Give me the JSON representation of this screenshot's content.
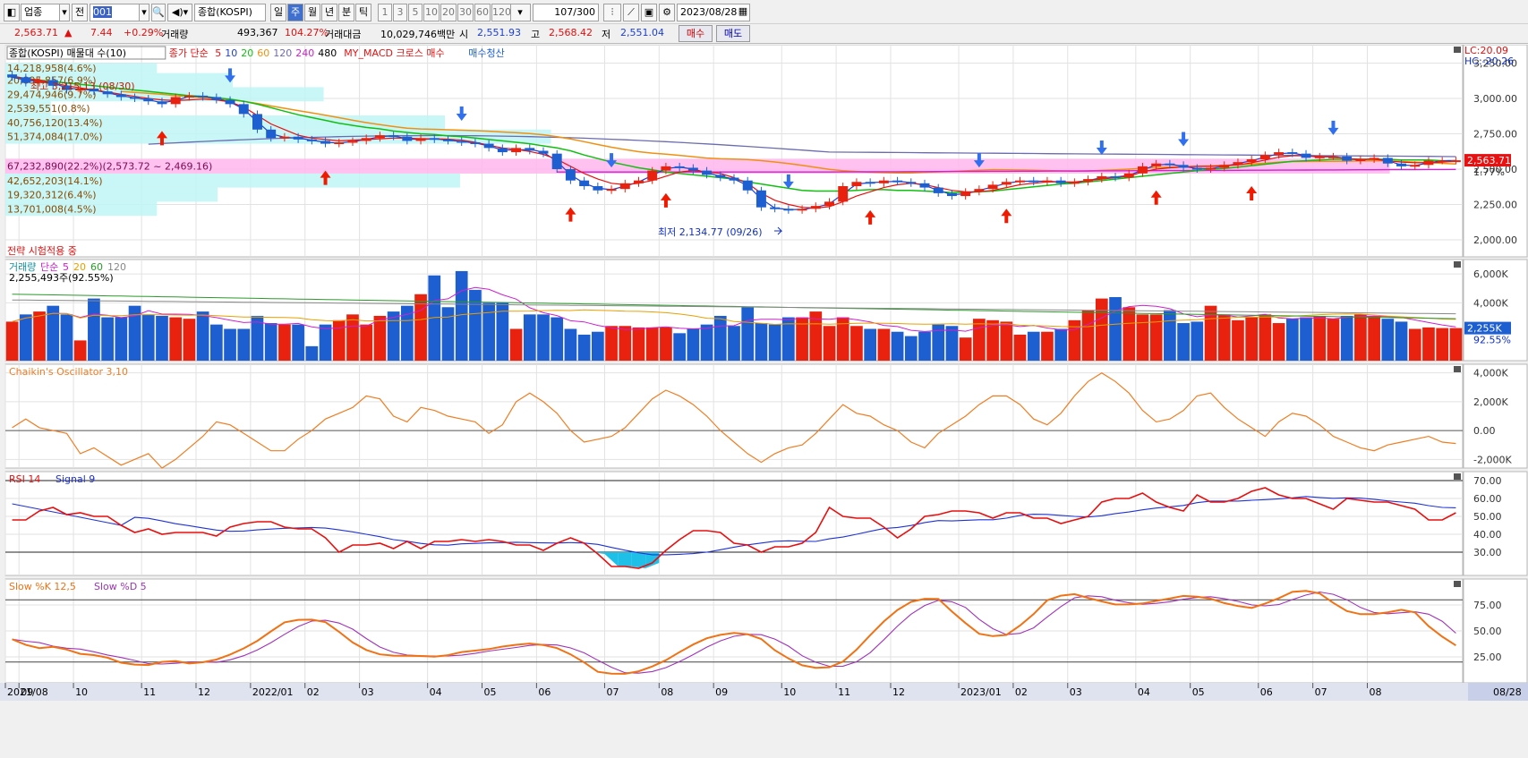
{
  "toolbar": {
    "market_select": "업종",
    "prev_label": "전",
    "code_value": "001",
    "name_value": "종합(KOSPI)",
    "periods": [
      "일",
      "주",
      "월",
      "년",
      "분",
      "틱"
    ],
    "active_period": "주",
    "numbers": [
      "1",
      "3",
      "5",
      "10",
      "20",
      "30",
      "60",
      "120"
    ],
    "count_value": "107",
    "count_total": "/300",
    "date_value": "2023/08/28"
  },
  "quote": {
    "price": "2,563.71",
    "change_arrow": "▲",
    "change": "7.44",
    "change_pct": "+0.29%",
    "volume_label": "거래량",
    "volume": "493,367",
    "volume_pct": "104.27%",
    "amount_label": "거래대금",
    "amount": "10,029,746백만",
    "open_label": "시",
    "open": "2,551.93",
    "high_label": "고",
    "high": "2,568.42",
    "low_label": "저",
    "low": "2,551.04",
    "buy_label": "매수",
    "sell_label": "매도"
  },
  "colors": {
    "up": "#e8220e",
    "down": "#1d5fd1",
    "ma5": "#e81010",
    "ma10": "#1d3fd0",
    "ma20": "#10c010",
    "ma60": "#f09010",
    "ma120": "#6b6bb0",
    "ma240": "#d020d0",
    "ma480": "#000000",
    "grid": "#e2e2e2",
    "band": "#bff5f5",
    "pinkband": "#ffb6ec",
    "chaikin": "#f07d22",
    "rsi": "#e80e0e",
    "signal": "#1e33d8",
    "slowk": "#f07214",
    "slowd": "#a033b8",
    "fill_low": "#1ec0e8",
    "fill_high": "#f0a080"
  },
  "price_panel": {
    "title_parts": [
      "종합(KOSPI) 매물대 수(10)",
      "종가 단순",
      "5",
      "10",
      "20",
      "60",
      "120",
      "240",
      "480",
      "MY_MACD 크로스 매수",
      "매수청산"
    ],
    "status": "전략 시험적용 중",
    "high_label": "최고 3,215.13 (08/30)",
    "low_label": "최저 2,134.77 (09/26)",
    "lc": "LC:20.09",
    "hc": "HC:-20.26",
    "current": "2,563.71",
    "current_pct": "1.77%",
    "y_ticks": [
      "3,250.00",
      "3,000.00",
      "2,750.00",
      "2,500.00",
      "2,250.00",
      "2,000.00"
    ],
    "y_vals": [
      3250,
      3000,
      2750,
      2500,
      2250,
      2000
    ],
    "profile": [
      {
        "label": "14,218,958(4.6%)",
        "w": 0.2,
        "lo": 3180,
        "hi": 3250
      },
      {
        "label": "20,895,857(6.9%)",
        "w": 0.3,
        "lo": 3080,
        "hi": 3180
      },
      {
        "label": "29,474,946(9.7%)",
        "w": 0.42,
        "lo": 2980,
        "hi": 3080
      },
      {
        "label": "2,539,551(0.8%)",
        "w": 0.06,
        "lo": 2880,
        "hi": 2980
      },
      {
        "label": "40,756,120(13.4%)",
        "w": 0.58,
        "lo": 2780,
        "hi": 2880
      },
      {
        "label": "51,374,084(17.0%)",
        "w": 0.72,
        "lo": 2680,
        "hi": 2780
      },
      {
        "label": "67,232,890(22.2%)(2,573.72 ~ 2,469.16)",
        "w": 0.95,
        "lo": 2469,
        "hi": 2574
      },
      {
        "label": "42,652,203(14.1%)",
        "w": 0.6,
        "lo": 2370,
        "hi": 2469
      },
      {
        "label": "19,320,312(6.4%)",
        "w": 0.28,
        "lo": 2270,
        "hi": 2370
      },
      {
        "label": "13,701,008(4.5%)",
        "w": 0.2,
        "lo": 2170,
        "hi": 2270
      }
    ]
  },
  "volume_panel": {
    "title_parts": [
      "거래량",
      "단순",
      "5",
      "20",
      "60",
      "120"
    ],
    "last_label": "2,255,493주(92.55%)",
    "current": "2,255K",
    "current_pct": "92.55%",
    "y_ticks": [
      "6,000K",
      "4,000K"
    ],
    "y_vals": [
      6000,
      4000
    ]
  },
  "chaikin_panel": {
    "title": "Chaikin's Oscillator 3,10",
    "y_ticks": [
      "4,000K",
      "2,000K",
      "0.00",
      "-2,000K"
    ],
    "y_vals": [
      4000,
      2000,
      0,
      -2000
    ]
  },
  "rsi_panel": {
    "title_parts": [
      "RSI 14",
      "Signal 9"
    ],
    "y_ticks": [
      "70.00",
      "60.00",
      "50.00",
      "40.00",
      "30.00"
    ],
    "y_vals": [
      70,
      60,
      50,
      40,
      30
    ]
  },
  "stoch_panel": {
    "title_parts": [
      "Slow %K 12,5",
      "Slow %D 5"
    ],
    "y_ticks": [
      "75.00",
      "50.00",
      "25.00"
    ],
    "y_vals": [
      75,
      50,
      25
    ]
  },
  "x_axis": {
    "labels": [
      "2021/08",
      "09",
      "10",
      "11",
      "12",
      "2022/01",
      "02",
      "03",
      "04",
      "05",
      "06",
      "07",
      "08",
      "09",
      "10",
      "11",
      "12",
      "2023/01",
      "02",
      "03",
      "04",
      "05",
      "06",
      "07",
      "08"
    ],
    "end_label": "08/28",
    "label_index": [
      0,
      1,
      5,
      10,
      14,
      18,
      22,
      26,
      31,
      35,
      39,
      44,
      48,
      52,
      57,
      61,
      65,
      70,
      74,
      78,
      83,
      87,
      92,
      96,
      100
    ]
  },
  "chart_data": {
    "type": "candlestick",
    "period": "weekly",
    "close": [
      3150,
      3110,
      3130,
      3090,
      3060,
      3070,
      3050,
      3030,
      3010,
      3000,
      2980,
      2960,
      3010,
      3020,
      3010,
      2990,
      2960,
      2890,
      2780,
      2720,
      2730,
      2710,
      2700,
      2680,
      2690,
      2700,
      2720,
      2740,
      2730,
      2700,
      2720,
      2710,
      2700,
      2690,
      2680,
      2650,
      2620,
      2650,
      2630,
      2610,
      2500,
      2420,
      2380,
      2350,
      2360,
      2400,
      2420,
      2490,
      2520,
      2510,
      2490,
      2460,
      2440,
      2420,
      2350,
      2230,
      2220,
      2210,
      2220,
      2240,
      2270,
      2380,
      2410,
      2400,
      2420,
      2410,
      2400,
      2370,
      2330,
      2310,
      2340,
      2360,
      2390,
      2410,
      2420,
      2410,
      2420,
      2400,
      2410,
      2430,
      2450,
      2440,
      2470,
      2520,
      2540,
      2530,
      2510,
      2500,
      2510,
      2530,
      2550,
      2570,
      2600,
      2620,
      2610,
      2580,
      2590,
      2590,
      2560,
      2570,
      2580,
      2540,
      2520,
      2530,
      2560,
      2560,
      2563
    ],
    "ma5": [
      3160,
      3140,
      3130,
      3110,
      3090,
      3075,
      3060,
      3045,
      3030,
      3015,
      3000,
      2990,
      2985,
      2990,
      2995,
      2990,
      2975,
      2940,
      2880,
      2820,
      2780,
      2740,
      2720,
      2710,
      2700,
      2705,
      2710,
      2715,
      2720,
      2720,
      2715,
      2715,
      2712,
      2705,
      2690,
      2670,
      2650,
      2640,
      2625,
      2605,
      2570,
      2520,
      2470,
      2430,
      2400,
      2390,
      2400,
      2420,
      2450,
      2480,
      2490,
      2480,
      2470,
      2440,
      2400,
      2330,
      2280,
      2250,
      2230,
      2225,
      2235,
      2270,
      2310,
      2340,
      2370,
      2390,
      2400,
      2390,
      2370,
      2350,
      2340,
      2340,
      2350,
      2370,
      2390,
      2400,
      2410,
      2410,
      2410,
      2420,
      2430,
      2440,
      2450,
      2480,
      2500,
      2510,
      2515,
      2520,
      2520,
      2525,
      2530,
      2545,
      2565,
      2585,
      2595,
      2595,
      2590,
      2585,
      2575,
      2570,
      2570,
      2560,
      2550,
      2545,
      2545,
      2550,
      2555
    ],
    "ma20": [
      3150,
      3140,
      3130,
      3120,
      3110,
      3100,
      3090,
      3080,
      3070,
      3060,
      3050,
      3040,
      3030,
      3020,
      3015,
      3005,
      2995,
      2980,
      2960,
      2935,
      2910,
      2885,
      2865,
      2845,
      2825,
      2810,
      2795,
      2785,
      2770,
      2760,
      2750,
      2745,
      2735,
      2730,
      2720,
      2710,
      2700,
      2690,
      2680,
      2665,
      2650,
      2630,
      2600,
      2575,
      2550,
      2530,
      2510,
      2495,
      2480,
      2470,
      2460,
      2450,
      2440,
      2430,
      2410,
      2395,
      2380,
      2365,
      2350,
      2345,
      2345,
      2345,
      2350,
      2355,
      2355,
      2350,
      2350,
      2345,
      2340,
      2335,
      2335,
      2340,
      2345,
      2355,
      2365,
      2375,
      2385,
      2395,
      2400,
      2410,
      2420,
      2430,
      2440,
      2450,
      2460,
      2470,
      2480,
      2490,
      2500,
      2505,
      2515,
      2525,
      2535,
      2545,
      2555,
      2560,
      2565,
      2570,
      2570,
      2570,
      2570,
      2570,
      2565,
      2565,
      2565,
      2560,
      2560
    ],
    "rsi": [
      48,
      53,
      55,
      51,
      52,
      50,
      45,
      41,
      43,
      40,
      41,
      41,
      39,
      44,
      46,
      47,
      44,
      43,
      43,
      38,
      30,
      34,
      35,
      32,
      36,
      32,
      36,
      37,
      36,
      37,
      36,
      34,
      31,
      35,
      38,
      35,
      29,
      22,
      21,
      24,
      31,
      37,
      42,
      41,
      35,
      34,
      30,
      33,
      35,
      41,
      55,
      50,
      49,
      44,
      38,
      43,
      50,
      51,
      53,
      52,
      49,
      52,
      52,
      49,
      46,
      48,
      50,
      58,
      60,
      63,
      58,
      55,
      53,
      62,
      58,
      60,
      64,
      66,
      62,
      60,
      57,
      54,
      60,
      59,
      58,
      56,
      54,
      48,
      48,
      52
    ]
  }
}
